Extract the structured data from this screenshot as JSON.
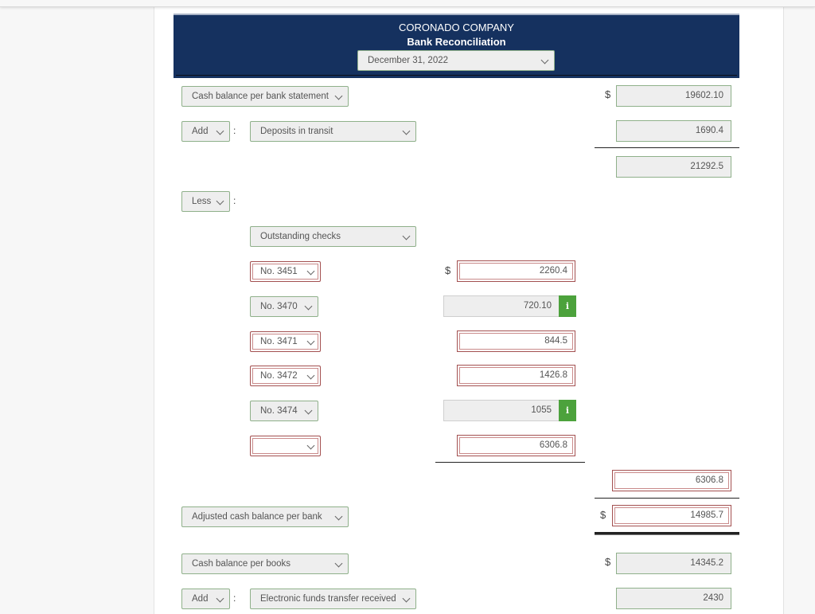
{
  "header": {
    "company": "CORONADO COMPANY",
    "title": "Bank Reconciliation",
    "date_select": "December 31, 2022"
  },
  "bank_section": {
    "start_label": "Cash balance per bank statement",
    "start_amount": "19602.10",
    "add_op": "Add",
    "add_item": "Deposits in transit",
    "add_amount": "1690.4",
    "subtotal": "21292.5",
    "less_op": "Less",
    "less_item": "Outstanding checks",
    "checks": [
      {
        "number": "No. 3451",
        "amount": "2260.4",
        "status": "incorrect",
        "info": false
      },
      {
        "number": "No. 3470",
        "amount": "720.10",
        "status": "given",
        "info": true
      },
      {
        "number": "No. 3471",
        "amount": "844.5",
        "status": "incorrect",
        "info": false
      },
      {
        "number": "No. 3472",
        "amount": "1426.8",
        "status": "incorrect",
        "info": false
      },
      {
        "number": "No. 3474",
        "amount": "1055",
        "status": "given",
        "info": true
      },
      {
        "number": "",
        "amount": "6306.8",
        "status": "incorrect",
        "info": false
      }
    ],
    "less_total": "6306.8",
    "adjusted_label": "Adjusted cash balance per bank",
    "adjusted_amount": "14985.7"
  },
  "books_section": {
    "start_label": "Cash balance per books",
    "start_amount": "14345.2",
    "add_op": "Add",
    "add_item": "Electronic funds transfer received",
    "add_amount": "2430"
  },
  "symbols": {
    "dollar": "$",
    "colon": ":",
    "info": "i"
  },
  "colors": {
    "header_bg": "#15315f",
    "valid_border": "#8fb08a",
    "error_border": "#a35050",
    "info_green": "#4ca23c"
  }
}
